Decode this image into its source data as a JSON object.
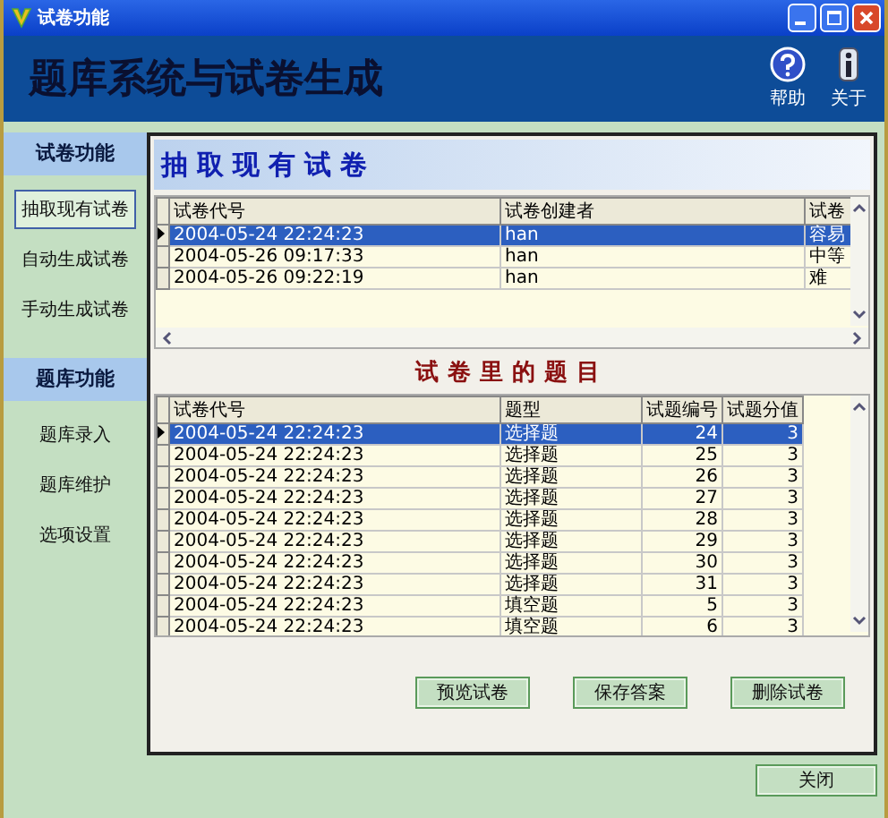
{
  "window": {
    "title": "试卷功能"
  },
  "header": {
    "title": "题库系统与试卷生成",
    "tools": [
      {
        "kind": "help",
        "label": "帮助"
      },
      {
        "kind": "about",
        "label": "关于"
      }
    ]
  },
  "sidebar": {
    "sections": [
      {
        "title": "试卷功能",
        "items": [
          {
            "label": "抽取现有试卷",
            "selected": true
          },
          {
            "label": "自动生成试卷",
            "selected": false
          },
          {
            "label": "手动生成试卷",
            "selected": false
          }
        ]
      },
      {
        "title": "题库功能",
        "items": [
          {
            "label": "题库录入",
            "selected": false
          },
          {
            "label": "题库维护",
            "selected": false
          },
          {
            "label": "选项设置",
            "selected": false
          }
        ]
      }
    ]
  },
  "papers": {
    "title": "抽取现有试卷",
    "columns": [
      "试卷代号",
      "试卷创建者",
      "试卷"
    ],
    "rows": [
      {
        "cells": [
          "2004-05-24 22:24:23",
          "han",
          "容易"
        ],
        "selected": true
      },
      {
        "cells": [
          "2004-05-26 09:17:33",
          "han",
          "中等"
        ],
        "selected": false
      },
      {
        "cells": [
          "2004-05-26 09:22:19",
          "han",
          "难"
        ],
        "selected": false
      }
    ]
  },
  "questions": {
    "title": "试卷里的题目",
    "columns": [
      "试卷代号",
      "题型",
      "试题编号",
      "试题分值"
    ],
    "rows": [
      {
        "cells": [
          "2004-05-24 22:24:23",
          "选择题",
          "24",
          "3"
        ],
        "selected": true
      },
      {
        "cells": [
          "2004-05-24 22:24:23",
          "选择题",
          "25",
          "3"
        ],
        "selected": false
      },
      {
        "cells": [
          "2004-05-24 22:24:23",
          "选择题",
          "26",
          "3"
        ],
        "selected": false
      },
      {
        "cells": [
          "2004-05-24 22:24:23",
          "选择题",
          "27",
          "3"
        ],
        "selected": false
      },
      {
        "cells": [
          "2004-05-24 22:24:23",
          "选择题",
          "28",
          "3"
        ],
        "selected": false
      },
      {
        "cells": [
          "2004-05-24 22:24:23",
          "选择题",
          "29",
          "3"
        ],
        "selected": false
      },
      {
        "cells": [
          "2004-05-24 22:24:23",
          "选择题",
          "30",
          "3"
        ],
        "selected": false
      },
      {
        "cells": [
          "2004-05-24 22:24:23",
          "选择题",
          "31",
          "3"
        ],
        "selected": false
      },
      {
        "cells": [
          "2004-05-24 22:24:23",
          "填空题",
          "5",
          "3"
        ],
        "selected": false
      },
      {
        "cells": [
          "2004-05-24 22:24:23",
          "填空题",
          "6",
          "3"
        ],
        "selected": false
      }
    ]
  },
  "actions": [
    "预览试卷",
    "保存答案",
    "删除试卷"
  ],
  "close_button": "关闭"
}
